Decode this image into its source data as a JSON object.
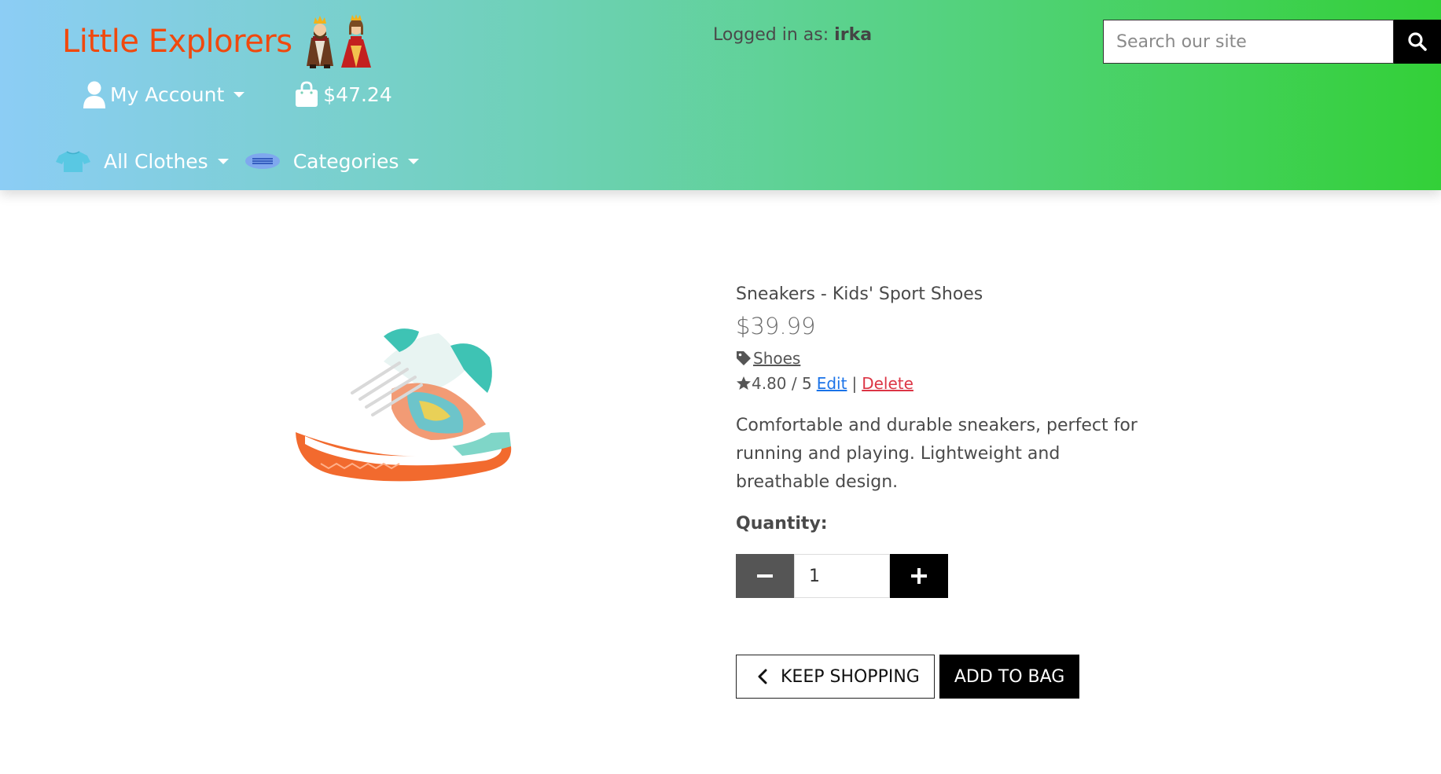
{
  "header": {
    "brand": "Little Explorers",
    "logged_in_label": "Logged in as:",
    "logged_in_user": "irka",
    "search_placeholder": "Search our site",
    "account_label": "My Account",
    "bag_total": "$47.24",
    "all_clothes_label": "All Clothes",
    "categories_label": "Categories"
  },
  "product": {
    "name": "Sneakers - Kids' Sport Shoes",
    "price": "$39.99",
    "category": "Shoes",
    "rating": "4.80 / 5",
    "edit_label": "Edit",
    "separator": "|",
    "delete_label": "Delete",
    "description": "Comfortable and durable sneakers, perfect for running and playing. Lightweight and breathable design.",
    "quantity_label": "Quantity:",
    "quantity_value": "1"
  },
  "actions": {
    "keep_shopping": "KEEP SHOPPING",
    "add_to_bag": "ADD TO BAG"
  },
  "colors": {
    "brand": "#f0490e",
    "edit_link": "#1a73e8",
    "delete_link": "#dc3545"
  }
}
